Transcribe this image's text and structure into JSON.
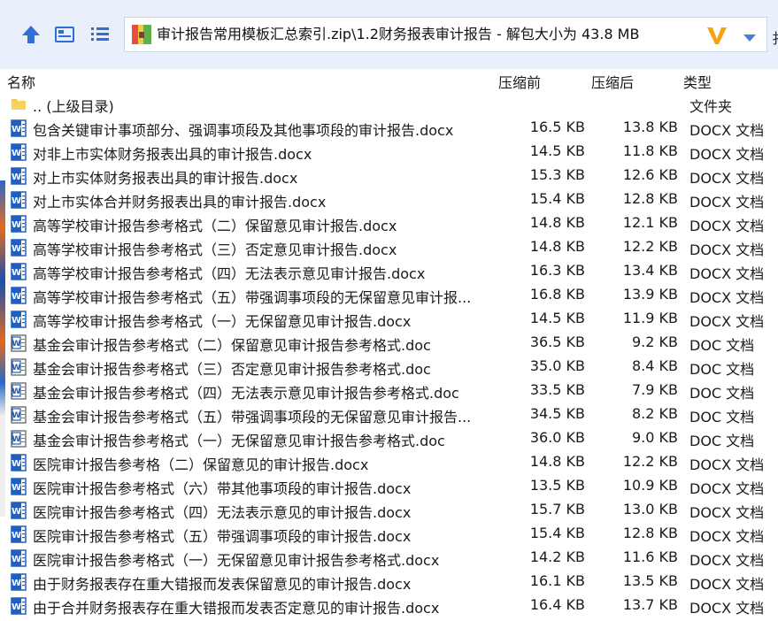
{
  "toolbar": {
    "path": "审计报告常用模板汇总索引.zip\\1.2财务报表审计报告 - 解包大小为 43.8 MB",
    "edge_char": "扌",
    "icons": [
      "up-arrow-icon",
      "view-icon",
      "list-icon",
      "zip-archive-icon",
      "v-logo-icon",
      "dropdown-arrow-icon"
    ]
  },
  "columns": {
    "name": "名称",
    "before": "压缩前",
    "after": "压缩后",
    "type": "类型"
  },
  "rows": [
    {
      "icon": "folder",
      "name": ".. (上级目录)",
      "before": "",
      "after": "",
      "type": "文件夹"
    },
    {
      "icon": "docx",
      "name": "包含关键审计事项部分、强调事项段及其他事项段的审计报告.docx",
      "before": "16.5 KB",
      "after": "13.8 KB",
      "type": "DOCX 文档"
    },
    {
      "icon": "docx",
      "name": "对非上市实体财务报表出具的审计报告.docx",
      "before": "14.5 KB",
      "after": "11.8 KB",
      "type": "DOCX 文档"
    },
    {
      "icon": "docx",
      "name": "对上市实体财务报表出具的审计报告.docx",
      "before": "15.3 KB",
      "after": "12.6 KB",
      "type": "DOCX 文档"
    },
    {
      "icon": "docx",
      "name": "对上市实体合并财务报表出具的审计报告.docx",
      "before": "15.4 KB",
      "after": "12.8 KB",
      "type": "DOCX 文档"
    },
    {
      "icon": "docx",
      "name": "高等学校审计报告参考格式（二）保留意见审计报告.docx",
      "before": "14.8 KB",
      "after": "12.1 KB",
      "type": "DOCX 文档"
    },
    {
      "icon": "docx",
      "name": "高等学校审计报告参考格式（三）否定意见审计报告.docx",
      "before": "14.8 KB",
      "after": "12.2 KB",
      "type": "DOCX 文档"
    },
    {
      "icon": "docx",
      "name": "高等学校审计报告参考格式（四）无法表示意见审计报告.docx",
      "before": "16.3 KB",
      "after": "13.4 KB",
      "type": "DOCX 文档"
    },
    {
      "icon": "docx",
      "name": "高等学校审计报告参考格式（五）带强调事项段的无保留意见审计报...",
      "before": "16.8 KB",
      "after": "13.9 KB",
      "type": "DOCX 文档"
    },
    {
      "icon": "docx",
      "name": "高等学校审计报告参考格式（一）无保留意见审计报告.docx",
      "before": "14.5 KB",
      "after": "11.9 KB",
      "type": "DOCX 文档"
    },
    {
      "icon": "doc",
      "name": "基金会审计报告参考格式（二）保留意见审计报告参考格式.doc",
      "before": "36.5 KB",
      "after": "9.2 KB",
      "type": "DOC 文档"
    },
    {
      "icon": "doc",
      "name": "基金会审计报告参考格式（三）否定意见审计报告参考格式.doc",
      "before": "35.0 KB",
      "after": "8.4 KB",
      "type": "DOC 文档"
    },
    {
      "icon": "doc",
      "name": "基金会审计报告参考格式（四）无法表示意见审计报告参考格式.doc",
      "before": "33.5 KB",
      "after": "7.9 KB",
      "type": "DOC 文档"
    },
    {
      "icon": "doc",
      "name": "基金会审计报告参考格式（五）带强调事项段的无保留意见审计报告...",
      "before": "34.5 KB",
      "after": "8.2 KB",
      "type": "DOC 文档"
    },
    {
      "icon": "doc",
      "name": "基金会审计报告参考格式（一）无保留意见审计报告参考格式.doc",
      "before": "36.0 KB",
      "after": "9.0 KB",
      "type": "DOC 文档"
    },
    {
      "icon": "docx",
      "name": "医院审计报告参考格（二）保留意见的审计报告.docx",
      "before": "14.8 KB",
      "after": "12.2 KB",
      "type": "DOCX 文档"
    },
    {
      "icon": "docx",
      "name": "医院审计报告参考格式（六）带其他事项段的审计报告.docx",
      "before": "13.5 KB",
      "after": "10.9 KB",
      "type": "DOCX 文档"
    },
    {
      "icon": "docx",
      "name": "医院审计报告参考格式（四）无法表示意见的审计报告.docx",
      "before": "15.7 KB",
      "after": "13.0 KB",
      "type": "DOCX 文档"
    },
    {
      "icon": "docx",
      "name": "医院审计报告参考格式（五）带强调事项段的审计报告.docx",
      "before": "15.4 KB",
      "after": "12.8 KB",
      "type": "DOCX 文档"
    },
    {
      "icon": "docx",
      "name": "医院审计报告参考格式（一）无保留意见审计报告参考格式.docx",
      "before": "14.2 KB",
      "after": "11.6 KB",
      "type": "DOCX 文档"
    },
    {
      "icon": "docx",
      "name": "由于财务报表存在重大错报而发表保留意见的审计报告.docx",
      "before": "16.1 KB",
      "after": "13.5 KB",
      "type": "DOCX 文档"
    },
    {
      "icon": "docx",
      "name": "由于合并财务报表存在重大错报而发表否定意见的审计报告.docx",
      "before": "16.4 KB",
      "after": "13.7 KB",
      "type": "DOCX 文档"
    }
  ],
  "colors": {
    "toolbar_bg": "#e9f0fb",
    "accent_blue": "#2f6fd6",
    "word_blue": "#1f5fbf",
    "folder_yellow": "#f5c842",
    "v_logo": "#f2a413"
  }
}
